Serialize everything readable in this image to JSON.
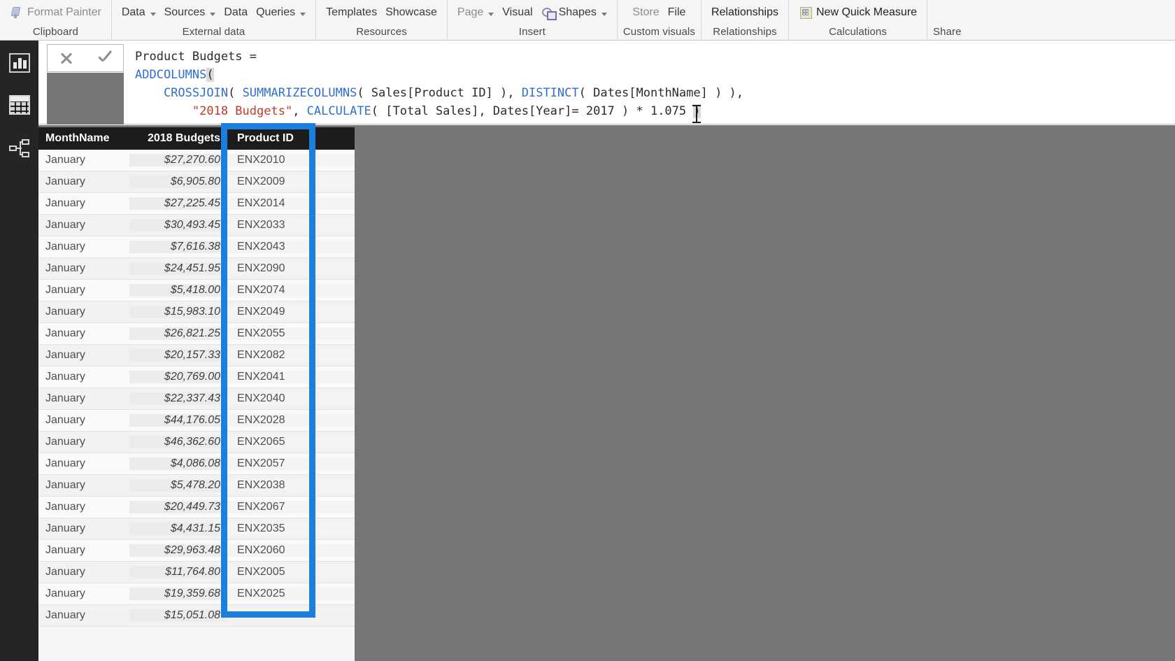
{
  "ribbon": {
    "groups": [
      {
        "name": "clipboard",
        "label": "Clipboard",
        "items": [
          {
            "name": "format-painter",
            "label": "Format Painter",
            "icon": "brush-icon",
            "dim": true,
            "caret": false
          }
        ]
      },
      {
        "name": "external-data",
        "label": "External data",
        "items": [
          {
            "name": "get-data",
            "label": "Data",
            "caret": true
          },
          {
            "name": "recent-sources",
            "label": "Sources",
            "caret": true
          },
          {
            "name": "enter-data",
            "label": "Data",
            "caret": false
          },
          {
            "name": "edit-queries",
            "label": "Queries",
            "caret": true
          }
        ]
      },
      {
        "name": "resources",
        "label": "Resources",
        "items": [
          {
            "name": "templates",
            "label": "Templates",
            "caret": false
          },
          {
            "name": "showcase",
            "label": "Showcase",
            "caret": false
          }
        ]
      },
      {
        "name": "insert",
        "label": "Insert",
        "items": [
          {
            "name": "new-page",
            "label": "Page",
            "caret": true,
            "dim": true
          },
          {
            "name": "new-visual",
            "label": "Visual",
            "caret": false
          },
          {
            "name": "shapes",
            "label": "Shapes",
            "icon": "shapes-icon",
            "caret": true
          }
        ]
      },
      {
        "name": "custom-visuals",
        "label": "Custom visuals",
        "items": [
          {
            "name": "from-store",
            "label": "Store",
            "caret": false,
            "dim": true
          },
          {
            "name": "from-file",
            "label": "File",
            "caret": false
          }
        ]
      },
      {
        "name": "relationships",
        "label": "Relationships",
        "items": [
          {
            "name": "manage-relationships",
            "label": "Relationships",
            "caret": false,
            "strong": true
          }
        ]
      },
      {
        "name": "calculations",
        "label": "Calculations",
        "items": [
          {
            "name": "new-quick-measure",
            "label": "New Quick Measure",
            "icon": "measure-icon",
            "caret": false,
            "strong": true
          }
        ]
      },
      {
        "name": "share",
        "label": "Share",
        "items": []
      }
    ]
  },
  "leftnav": {
    "items": [
      {
        "name": "report-view",
        "icon": "report-icon"
      },
      {
        "name": "data-view",
        "icon": "table-icon"
      },
      {
        "name": "model-view",
        "icon": "model-icon"
      }
    ]
  },
  "formula_bar": {
    "cancel_label": "cancel",
    "commit_label": "commit",
    "lines": [
      {
        "segments": [
          {
            "t": "Product Budgets =",
            "c": "plain"
          }
        ]
      },
      {
        "segments": [
          {
            "t": "ADDCOLUMNS",
            "c": "fn"
          },
          {
            "t": "(",
            "c": "par"
          }
        ]
      },
      {
        "segments": [
          {
            "t": "    ",
            "c": "plain"
          },
          {
            "t": "CROSSJOIN",
            "c": "fn"
          },
          {
            "t": "( ",
            "c": "plain"
          },
          {
            "t": "SUMMARIZECOLUMNS",
            "c": "fn"
          },
          {
            "t": "( Sales[Product ID] ), ",
            "c": "plain"
          },
          {
            "t": "DISTINCT",
            "c": "fn"
          },
          {
            "t": "( Dates[MonthName] ) ),",
            "c": "plain"
          }
        ]
      },
      {
        "segments": [
          {
            "t": "        ",
            "c": "plain"
          },
          {
            "t": "\"2018 Budgets\"",
            "c": "str"
          },
          {
            "t": ", ",
            "c": "plain"
          },
          {
            "t": "CALCULATE",
            "c": "fn"
          },
          {
            "t": "( [Total Sales], Dates[Year]= 2017 ) * 1.075 ",
            "c": "plain"
          },
          {
            "t": ")",
            "c": "par"
          }
        ]
      }
    ],
    "plain_text": "Product Budgets =\nADDCOLUMNS(\n    CROSSJOIN( SUMMARIZECOLUMNS( Sales[Product ID] ), DISTINCT( Dates[MonthName] ) ),\n        \"2018 Budgets\", CALCULATE( [Total Sales], Dates[Year]= 2017 ) * 1.075 )"
  },
  "table": {
    "columns": [
      {
        "name": "MonthName",
        "label": "MonthName",
        "align": "left"
      },
      {
        "name": "2018 Budgets",
        "label": "2018 Budgets",
        "align": "right"
      },
      {
        "name": "Product ID",
        "label": "Product ID",
        "align": "left"
      }
    ],
    "rows": [
      {
        "month": "January",
        "budget": "$27,270.60",
        "product": "ENX2010"
      },
      {
        "month": "January",
        "budget": "$6,905.80",
        "product": "ENX2009"
      },
      {
        "month": "January",
        "budget": "$27,225.45",
        "product": "ENX2014"
      },
      {
        "month": "January",
        "budget": "$30,493.45",
        "product": "ENX2033"
      },
      {
        "month": "January",
        "budget": "$7,616.38",
        "product": "ENX2043"
      },
      {
        "month": "January",
        "budget": "$24,451.95",
        "product": "ENX2090"
      },
      {
        "month": "January",
        "budget": "$5,418.00",
        "product": "ENX2074"
      },
      {
        "month": "January",
        "budget": "$15,983.10",
        "product": "ENX2049"
      },
      {
        "month": "January",
        "budget": "$26,821.25",
        "product": "ENX2055"
      },
      {
        "month": "January",
        "budget": "$20,157.33",
        "product": "ENX2082"
      },
      {
        "month": "January",
        "budget": "$20,769.00",
        "product": "ENX2041"
      },
      {
        "month": "January",
        "budget": "$22,337.43",
        "product": "ENX2040"
      },
      {
        "month": "January",
        "budget": "$44,176.05",
        "product": "ENX2028"
      },
      {
        "month": "January",
        "budget": "$46,362.60",
        "product": "ENX2065"
      },
      {
        "month": "January",
        "budget": "$4,086.08",
        "product": "ENX2057"
      },
      {
        "month": "January",
        "budget": "$5,478.20",
        "product": "ENX2038"
      },
      {
        "month": "January",
        "budget": "$20,449.73",
        "product": "ENX2067"
      },
      {
        "month": "January",
        "budget": "$4,431.15",
        "product": "ENX2035"
      },
      {
        "month": "January",
        "budget": "$29,963.48",
        "product": "ENX2060"
      },
      {
        "month": "January",
        "budget": "$11,764.80",
        "product": "ENX2005"
      },
      {
        "month": "January",
        "budget": "$19,359.68",
        "product": "ENX2025"
      },
      {
        "month": "January",
        "budget": "$15,051.08",
        "product": ""
      }
    ]
  },
  "annotation": {
    "name": "product-id-column-highlight",
    "color": "#1b7fe0"
  },
  "colors": {
    "canvas_bg": "#767676",
    "header_bg": "#1c1c1c",
    "ribbon_bg": "#f5f5f5",
    "nav_bg": "#252526",
    "accent": "#1b7fe0"
  }
}
